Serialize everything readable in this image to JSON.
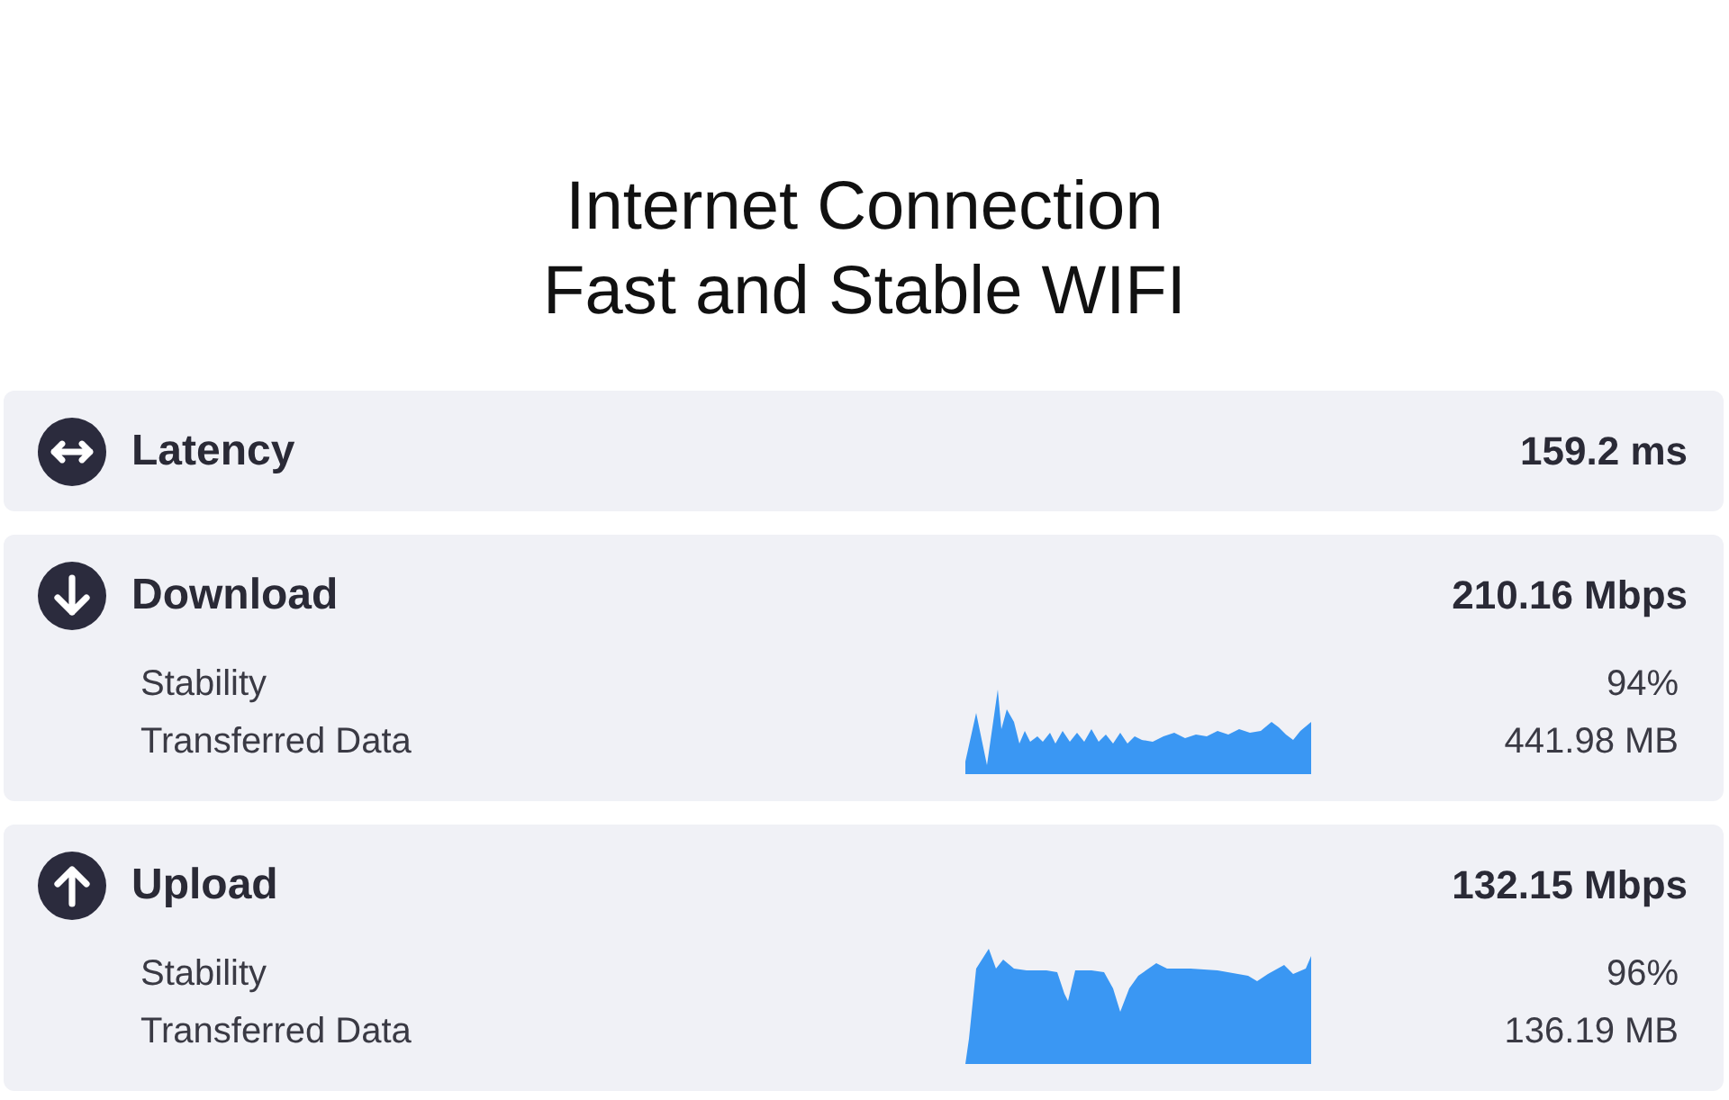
{
  "title": "Internet Connection",
  "subtitle": "Fast and Stable WIFI",
  "metrics": [
    {
      "kind": "latency",
      "label": "Latency",
      "value": "159.2 ms"
    },
    {
      "kind": "download",
      "label": "Download",
      "value": "210.16 Mbps",
      "details": [
        {
          "label": "Stability",
          "value": "94%"
        },
        {
          "label": "Transferred Data",
          "value": "441.98 MB"
        }
      ]
    },
    {
      "kind": "upload",
      "label": "Upload",
      "value": "132.15 Mbps",
      "details": [
        {
          "label": "Stability",
          "value": "96%"
        },
        {
          "label": "Transferred Data",
          "value": "136.19 MB"
        }
      ]
    }
  ]
}
